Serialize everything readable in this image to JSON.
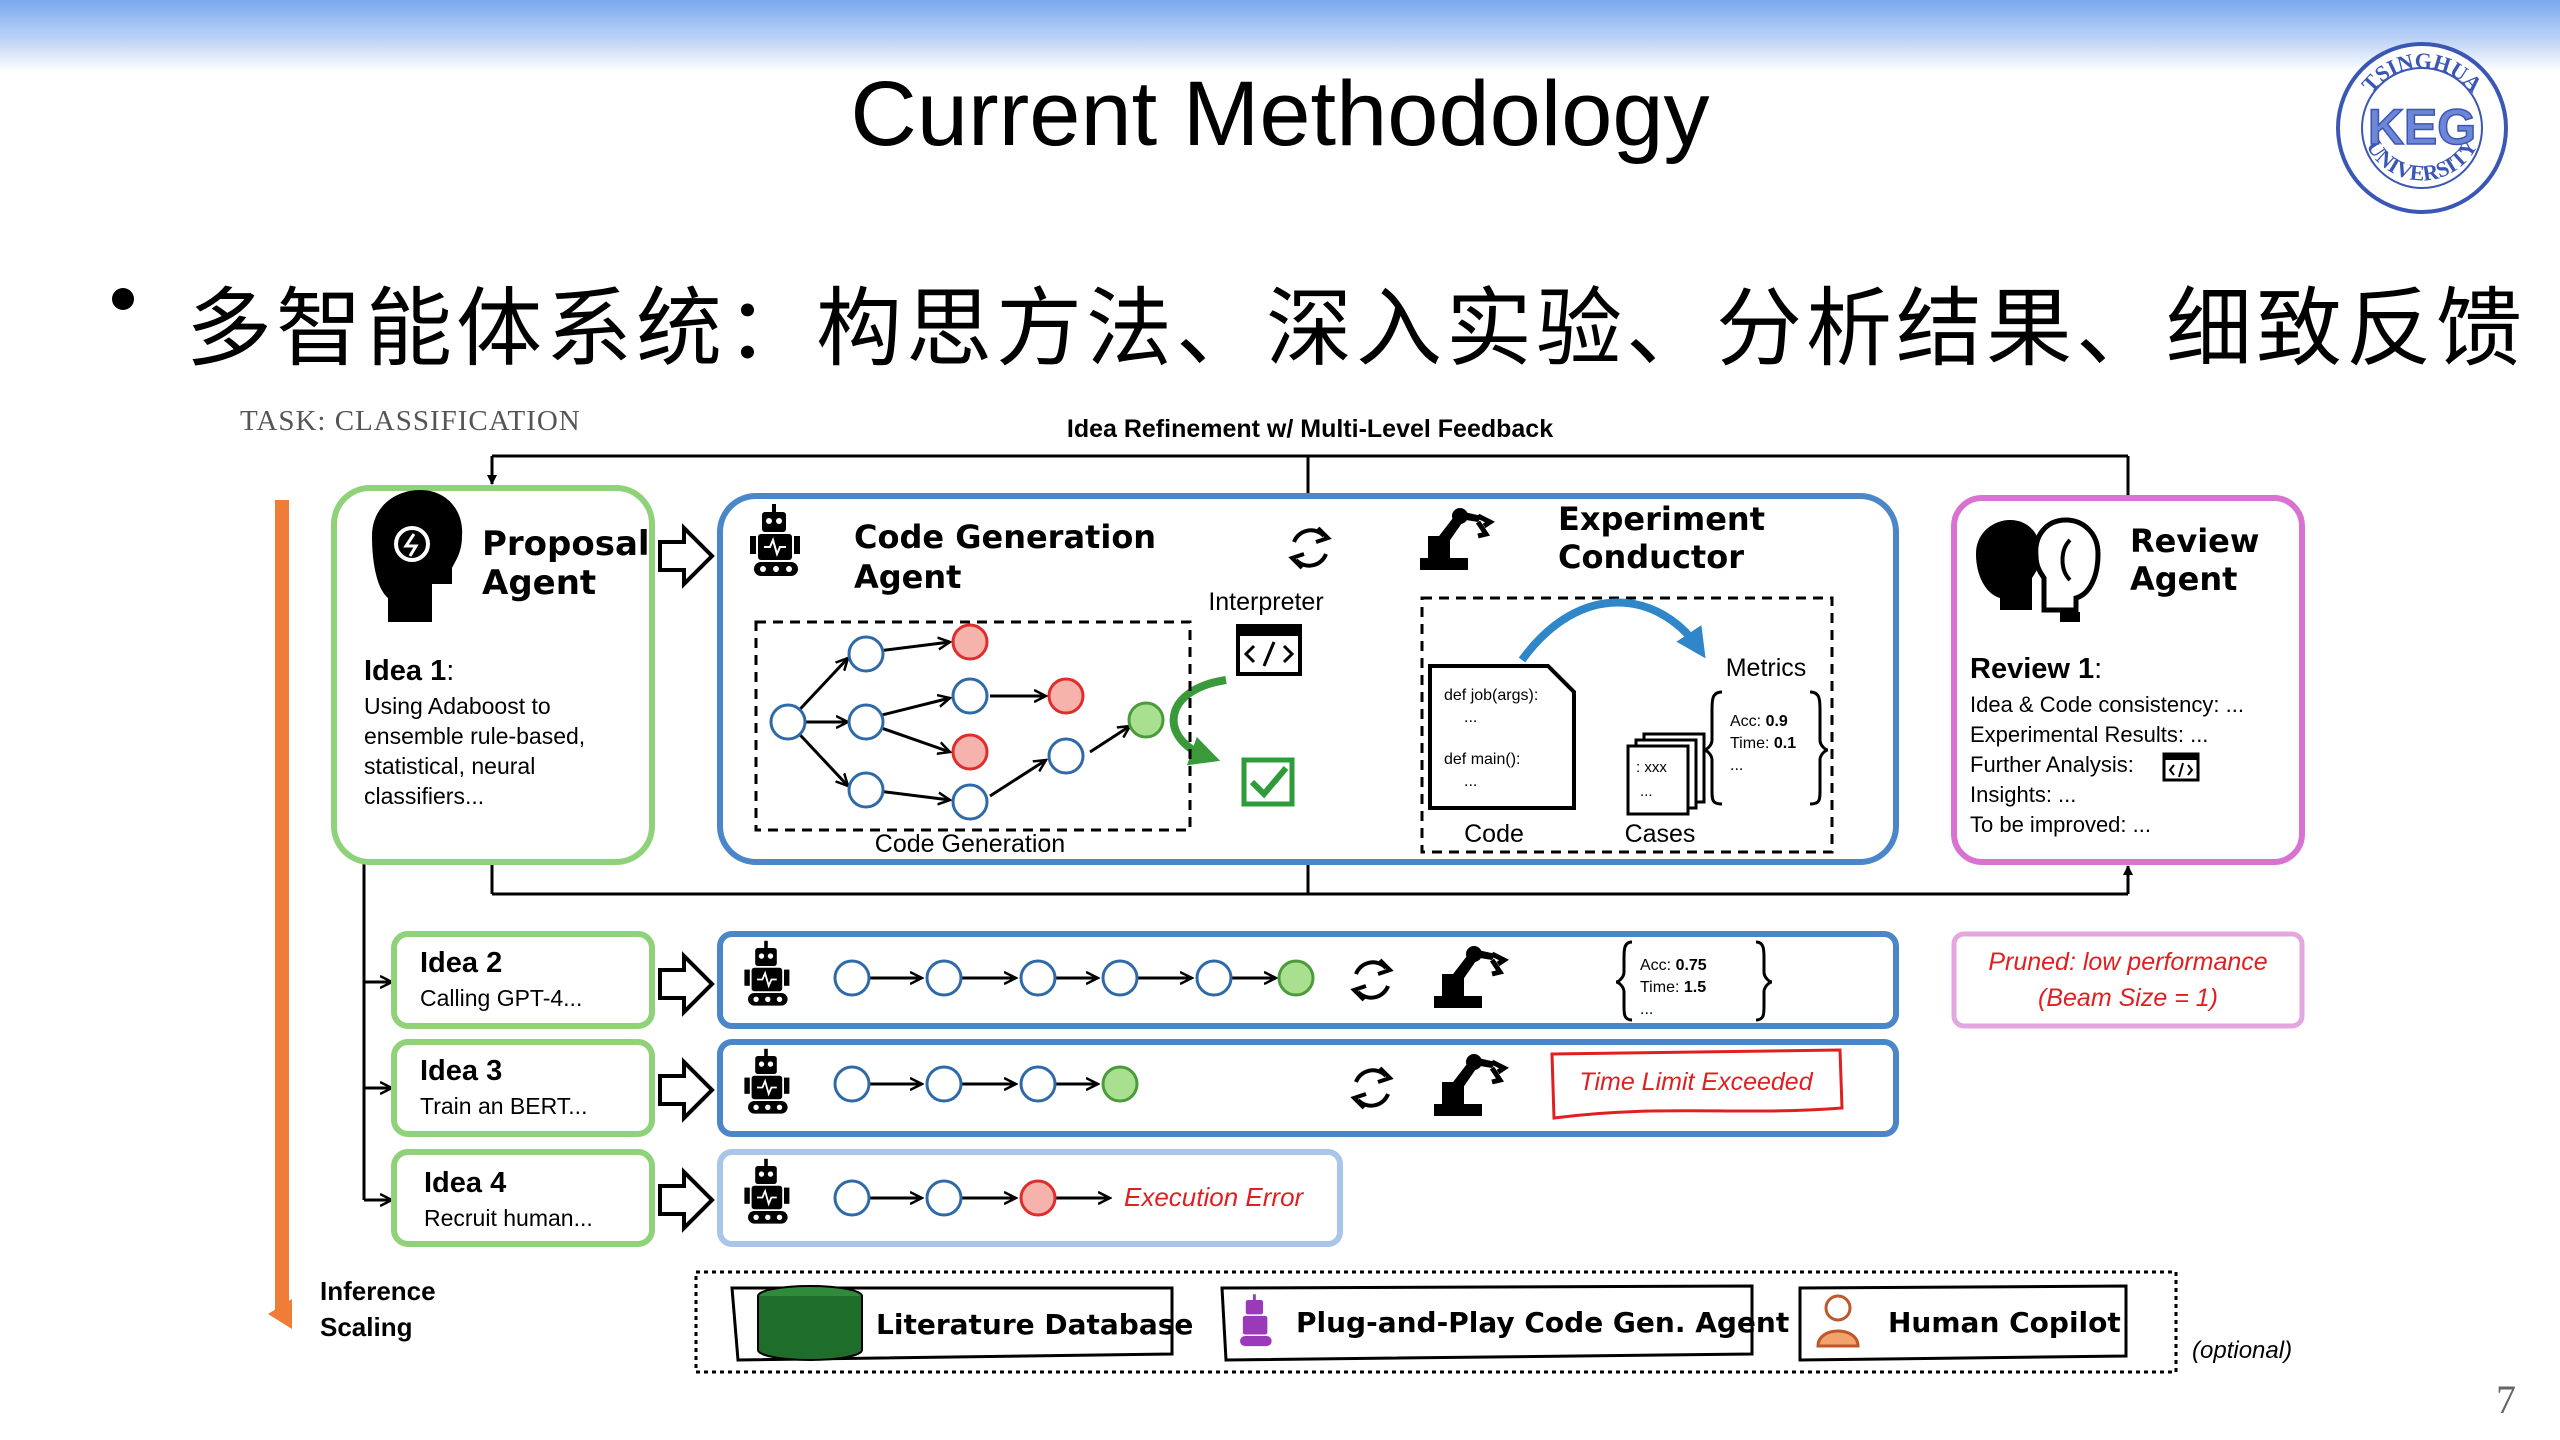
{
  "slide": {
    "title": "Current Methodology",
    "bullet": "多智能体系统：构思方法、深入实验、分析结果、细致反馈",
    "page_number": "7",
    "logo_text": {
      "top": "TSINGHUA",
      "center": "KEG",
      "bottom": "UNIVERSITY"
    }
  },
  "diagram": {
    "task_label": "TASK: CLASSIFICATION",
    "feedback_label": "Idea Refinement w/ Multi-Level Feedback",
    "inference_label_line1": "Inference",
    "inference_label_line2": "Scaling",
    "proposal": {
      "title_line1": "Proposal",
      "title_line2": "Agent",
      "idea_title": "Idea 1",
      "idea_colon": ":",
      "idea_lines": [
        "Using Adaboost to",
        "ensemble rule-based,",
        "statistical, neural",
        "classifiers..."
      ]
    },
    "codegen": {
      "title_line1": "Code Generation",
      "title_line2": "Agent",
      "interpreter_label": "Interpreter",
      "code_generation_label": "Code Generation"
    },
    "experiment": {
      "title_line1": "Experiment",
      "title_line2": "Conductor",
      "metrics_label": "Metrics",
      "code_label": "Code",
      "cases_label": "Cases",
      "code_lines": [
        "def job(args):",
        "...",
        "def main():",
        "..."
      ],
      "case_lines": [
        ": xxx",
        "..."
      ],
      "acc_label": "Acc: ",
      "acc_value": "0.9",
      "time_label": "Time: ",
      "time_value": "0.1",
      "ellipsis": "..."
    },
    "review": {
      "title_line1": "Review",
      "title_line2": "Agent",
      "review_title": "Review 1",
      "review_colon": ":",
      "lines": [
        "Idea & Code consistency: ...",
        "Experimental Results: ...",
        "Further Analysis:",
        "Insights: ...",
        "To be improved: ..."
      ]
    },
    "idea2": {
      "title": "Idea 2",
      "desc": "Calling GPT-4...",
      "acc_label": "Acc: ",
      "acc_value": "0.75",
      "time_label": "Time: ",
      "time_value": "1.5",
      "ellipsis": "...",
      "pruned_line1": "Pruned: low performance",
      "pruned_line2": "(Beam Size = 1)"
    },
    "idea3": {
      "title": "Idea 3",
      "desc": "Train an BERT...",
      "status": "Time Limit Exceeded"
    },
    "idea4": {
      "title": "Idea 4",
      "desc": "Recruit human...",
      "status": "Execution Error"
    },
    "tools": {
      "literature": "Literature Database",
      "plugplay": "Plug-and-Play Code Gen. Agent",
      "copilot": "Human Copilot",
      "optional": "(optional)"
    }
  },
  "colors": {
    "green_border": "#8fd27a",
    "blue_border": "#4a86c8",
    "light_blue_border": "#a9c6e8",
    "pink_border": "#d873d2",
    "light_pink_border": "#e3a6df",
    "orange_arrow": "#ef7d38",
    "node_blue": "#2f6aa8",
    "node_red_fill": "#f6b3ab",
    "node_red_stroke": "#e02c2c",
    "node_green_fill": "#a9e08f",
    "node_green_stroke": "#4b9a3c",
    "error_red": "#e02020",
    "db_green": "#1f6d2a",
    "check_green": "#2e9c3a"
  }
}
